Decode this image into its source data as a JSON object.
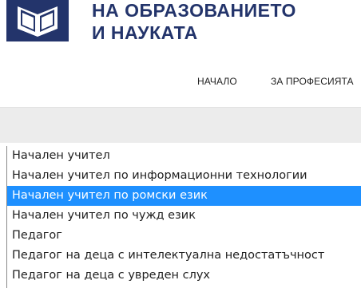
{
  "header": {
    "org_line_1": "НА ОБРАЗОВАНИЕТО",
    "org_line_2": "И НАУКАТА",
    "brand_color": "#23346b",
    "logo_icon": "ministry-book-emblem-icon"
  },
  "nav": {
    "items": [
      {
        "label": "НАЧАЛО"
      },
      {
        "label": "ЗА ПРОФЕСИЯТА"
      }
    ]
  },
  "dropdown": {
    "selected_index": 2,
    "highlight_color": "#1e90ff",
    "options": [
      {
        "label": "Начален учител"
      },
      {
        "label": "Начален учител по информационни технологии"
      },
      {
        "label": "Начален учител по ромски език"
      },
      {
        "label": "Начален учител по чужд език"
      },
      {
        "label": "Педагог"
      },
      {
        "label": "Педагог на деца с интелектуална недостатъчност"
      },
      {
        "label": "Педагог на деца с увреден слух"
      }
    ]
  }
}
